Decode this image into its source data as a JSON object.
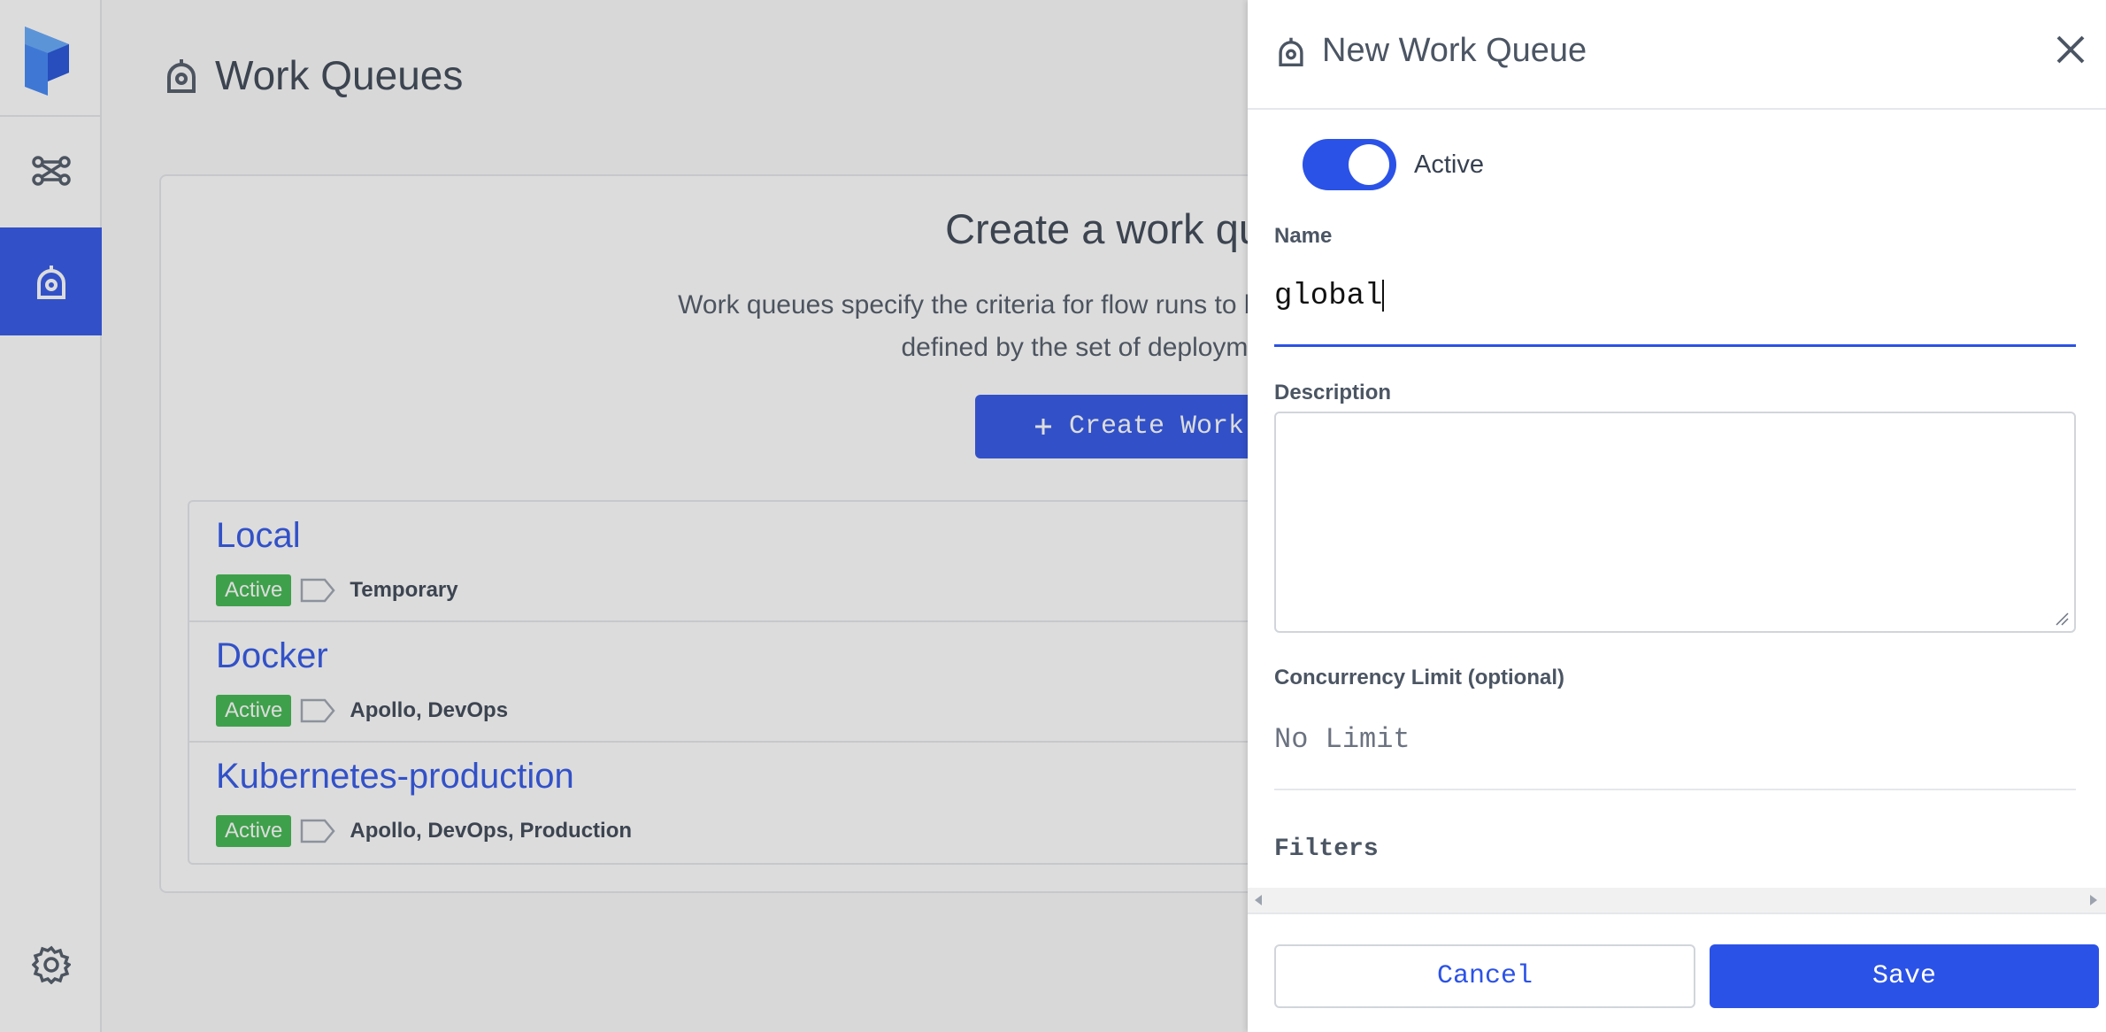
{
  "colors": {
    "accent": "#2b52e7",
    "active_badge": "#3bb54a"
  },
  "sidebar": {
    "logo": "prefect-logo",
    "items": [
      {
        "name": "flows",
        "icon": "flow-nodes-icon"
      },
      {
        "name": "work-queues",
        "icon": "work-queue-icon",
        "active": true
      },
      {
        "name": "settings",
        "icon": "gear-icon"
      }
    ]
  },
  "page": {
    "title": "Work Queues"
  },
  "empty_state": {
    "title": "Create a work queue to g",
    "desc_line1": "Work queues specify the criteria for flow runs to be picked up by a corresponding age",
    "desc_line2": "defined by the set of deployments, tags, or flow",
    "button_label": "Create Work Queu"
  },
  "queues": [
    {
      "name": "Local",
      "status": "Active",
      "tags": "Temporary"
    },
    {
      "name": "Docker",
      "status": "Active",
      "tags": "Apollo, DevOps"
    },
    {
      "name": "Kubernetes-production",
      "status": "Active",
      "tags": "Apollo, DevOps, Production"
    }
  ],
  "drawer": {
    "title": "New Work Queue",
    "active_toggle_label": "Active",
    "active": true,
    "name_label": "Name",
    "name_value": "global",
    "description_label": "Description",
    "description_value": "",
    "concurrency_label": "Concurrency Limit (optional)",
    "concurrency_placeholder": "No Limit",
    "filters_label": "Filters",
    "cancel_label": "Cancel",
    "save_label": "Save"
  }
}
